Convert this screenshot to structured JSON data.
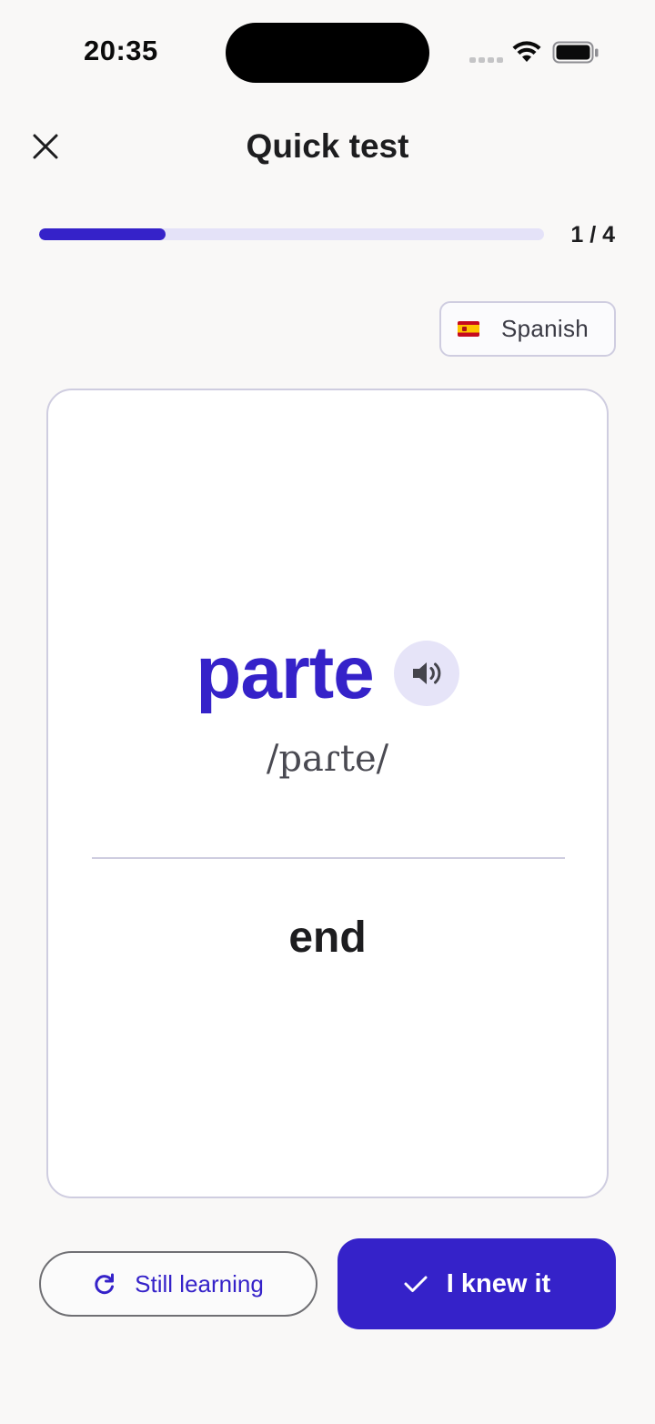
{
  "status_bar": {
    "time": "20:35"
  },
  "header": {
    "title": "Quick test",
    "close_icon": "close-icon"
  },
  "progress": {
    "current": 1,
    "total": 4,
    "label": "1 / 4",
    "fraction": 0.25
  },
  "language": {
    "label": "Spanish",
    "flag": "spain-flag-icon"
  },
  "card": {
    "word": "parte",
    "phonetic": "/paɾte/",
    "translation": "end",
    "speaker_icon": "speaker-icon"
  },
  "actions": {
    "still_learning": {
      "label": "Still learning",
      "icon": "refresh-icon"
    },
    "knew_it": {
      "label": "I knew it",
      "icon": "checkmark-icon"
    }
  },
  "colors": {
    "accent": "#3522c9",
    "accent_light": "#e4e2f8",
    "background": "#f9f8f7",
    "border": "#cfcde0"
  }
}
